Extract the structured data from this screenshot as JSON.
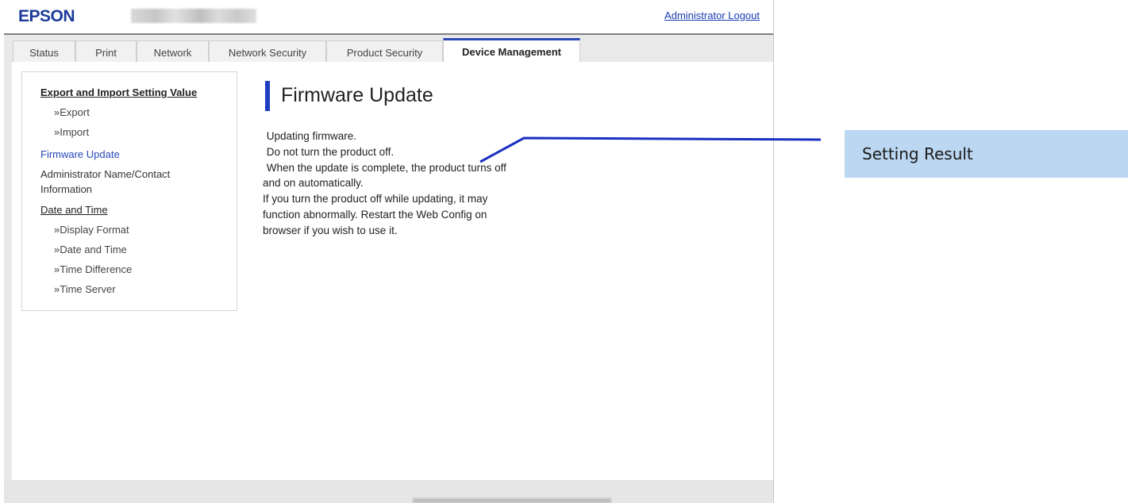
{
  "header": {
    "logo": "EPSON",
    "admin_logout": "Administrator Logout"
  },
  "tabs": [
    {
      "label": "Status"
    },
    {
      "label": "Print"
    },
    {
      "label": "Network"
    },
    {
      "label": "Network Security"
    },
    {
      "label": "Product Security"
    },
    {
      "label": "Device Management",
      "active": true
    }
  ],
  "sidebar": {
    "export_import_header": "Export and Import Setting Value",
    "export": "»Export",
    "import": "»Import",
    "firmware_update": "Firmware Update",
    "admin_name_line1": "Administrator Name/Contact",
    "admin_name_line2": "Information",
    "date_time_header": "Date and Time",
    "display_format": "»Display Format",
    "date_and_time": "»Date and Time",
    "time_difference": "»Time Difference",
    "time_server": "»Time Server"
  },
  "main": {
    "title": "Firmware Update",
    "lines": [
      " Updating firmware.",
      " Do not turn the product off.",
      " When the update is complete, the product turns off",
      "and on automatically.",
      "If you turn the product off while updating, it may",
      "function abnormally. Restart the Web Config on",
      "browser if you wish to use it."
    ]
  },
  "callout": {
    "label": "Setting Result",
    "line_color": "#1a2fc0",
    "box_color": "#bcd7f1"
  },
  "colors": {
    "brand": "#1b3a9a",
    "accent": "#2a49b5"
  }
}
